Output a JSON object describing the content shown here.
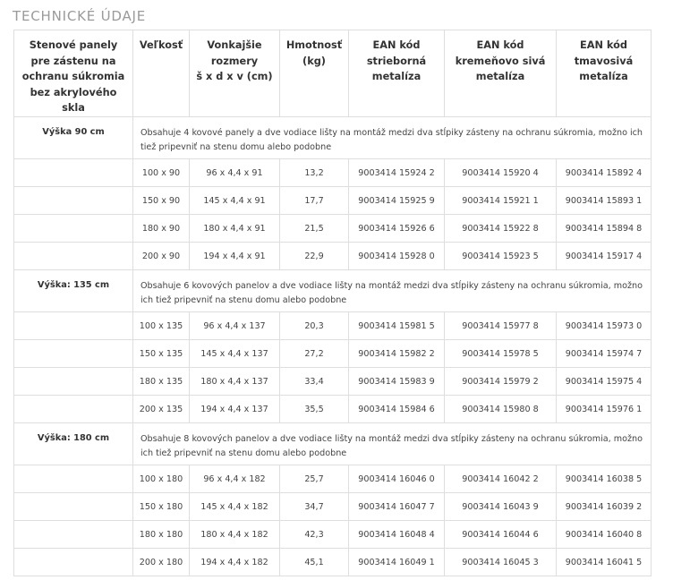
{
  "heading": "TECHNICKÉ ÚDAJE",
  "columns": [
    [
      "Stenové panely",
      "pre zástenu na",
      "ochranu súkromia",
      "bez akrylového skla"
    ],
    [
      "Veľkosť"
    ],
    [
      "Vonkajšie",
      "rozmery",
      "š x d x v (cm)"
    ],
    [
      "Hmotnosť",
      "(kg)"
    ],
    [
      "EAN kód",
      "strieborná",
      "metalíza"
    ],
    [
      "EAN kód",
      "kremeňovo sivá",
      "metalíza"
    ],
    [
      "EAN kód",
      "tmavosivá",
      "metalíza"
    ]
  ],
  "groups": [
    {
      "label": "Výška 90 cm",
      "description": "Obsahuje 4 kovové panely a dve vodiace lišty na montáž medzi dva stĺpiky zásteny na ochranu súkromia, možno ich tiež pripevniť na stenu domu alebo podobne",
      "rows": [
        [
          "100 x 90",
          "96 x 4,4 x 91",
          "13,2",
          "9003414 15924 2",
          "9003414 15920 4",
          "9003414 15892 4"
        ],
        [
          "150 x 90",
          "145 x 4,4 x 91",
          "17,7",
          "9003414 15925 9",
          "9003414 15921 1",
          "9003414 15893 1"
        ],
        [
          "180 x 90",
          "180 x 4,4 x 91",
          "21,5",
          "9003414 15926 6",
          "9003414 15922 8",
          "9003414 15894 8"
        ],
        [
          "200 x 90",
          "194 x 4,4 x 91",
          "22,9",
          "9003414 15928 0",
          "9003414 15923 5",
          "9003414 15917 4"
        ]
      ]
    },
    {
      "label": "Výška: 135 cm",
      "description": "Obsahuje 6 kovových panelov a dve vodiace lišty na montáž medzi dva stĺpiky zásteny na ochranu súkromia, možno ich tiež pripevniť na stenu domu alebo podobne",
      "rows": [
        [
          "100 x 135",
          "96 x 4,4 x 137",
          "20,3",
          "9003414 15981 5",
          "9003414 15977 8",
          "9003414 15973 0"
        ],
        [
          "150 x 135",
          "145 x 4,4 x 137",
          "27,2",
          "9003414 15982 2",
          "9003414 15978 5",
          "9003414 15974 7"
        ],
        [
          "180 x 135",
          "180 x 4,4 x 137",
          "33,4",
          "9003414 15983 9",
          "9003414 15979 2",
          "9003414 15975 4"
        ],
        [
          "200 x 135",
          "194 x 4,4 x 137",
          "35,5",
          "9003414 15984 6",
          "9003414 15980 8",
          "9003414 15976 1"
        ]
      ]
    },
    {
      "label": "Výška: 180 cm",
      "description": "Obsahuje 8 kovových panelov a dve vodiace lišty na montáž medzi dva stĺpiky zásteny na ochranu súkromia, možno ich tiež pripevniť na stenu domu alebo podobne",
      "rows": [
        [
          "100 x 180",
          "96 x 4,4 x 182",
          "25,7",
          "9003414 16046 0",
          "9003414 16042 2",
          "9003414 16038 5"
        ],
        [
          "150 x 180",
          "145 x 4,4 x 182",
          "34,7",
          "9003414 16047 7",
          "9003414 16043 9",
          "9003414 16039 2"
        ],
        [
          "180 x 180",
          "180 x 4,4 x 182",
          "42,3",
          "9003414 16048 4",
          "9003414 16044 6",
          "9003414 16040 8"
        ],
        [
          "200 x 180",
          "194 x 4,4 x 182",
          "45,1",
          "9003414 16049 1",
          "9003414 16045 3",
          "9003414 16041 5"
        ]
      ]
    }
  ]
}
